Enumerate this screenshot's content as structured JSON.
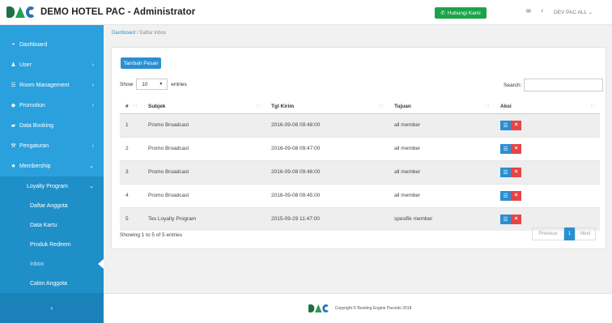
{
  "header": {
    "title": "DEMO HOTEL PAC - Administrator",
    "contact_button": "Hubungi Kami",
    "user_menu": "DEV PAC ALL"
  },
  "sidebar": {
    "items": [
      {
        "label": "Dashboard",
        "icon": "dashboard-icon",
        "chevron": ""
      },
      {
        "label": "User",
        "icon": "user-icon",
        "chevron": "›"
      },
      {
        "label": "Room Management",
        "icon": "list-icon",
        "chevron": "›"
      },
      {
        "label": "Promotion",
        "icon": "tag-icon",
        "chevron": "›"
      },
      {
        "label": "Data Booking",
        "icon": "book-icon",
        "chevron": ""
      },
      {
        "label": "Pengaturan",
        "icon": "wrench-icon",
        "chevron": "›"
      },
      {
        "label": "Membership",
        "icon": "star-icon",
        "chevron": "⌄"
      }
    ],
    "submenu": {
      "label": "Loyalty Program",
      "chevron": "⌄"
    },
    "sub_items": [
      "Daftar Anggota",
      "Data Kartu",
      "Produk Redeem",
      "Inbox",
      "Calon Anggota"
    ],
    "collapse_label": "‹"
  },
  "breadcrumb": {
    "home": "Dashboard",
    "separator": "/",
    "current": "Daftar Inbox"
  },
  "panel": {
    "add_button": "Tambah Pesan",
    "show_label": "Show",
    "show_value": "10",
    "entries_label": "entries",
    "search_label": "Search:",
    "search_value": ""
  },
  "table": {
    "columns": [
      "#",
      "Subjek",
      "Tgl Kirim",
      "Tujuan",
      "Aksi"
    ],
    "rows": [
      [
        "1",
        "Promo Broadcast",
        "2016-09-08 09:48:00",
        "all member"
      ],
      [
        "2",
        "Promo Broadcast",
        "2016-09-08 09:47:00",
        "all member"
      ],
      [
        "3",
        "Promo Broadcast",
        "2016-09-08 09:46:00",
        "all member"
      ],
      [
        "4",
        "Promo Broadcast",
        "2016-09-08 09:45:00",
        "all member"
      ],
      [
        "5",
        "Tes Loyalty Program",
        "2015-09-29 11:47:00",
        "spesifik member"
      ]
    ]
  },
  "pagination": {
    "info": "Showing 1 to 5 of 5 entries",
    "previous": "Previous",
    "current": "1",
    "next": "Next"
  },
  "footer": {
    "copyright": "Copyright © Booking Engine Pacindo 2018"
  },
  "colors": {
    "sidebar": "#2aa0dc",
    "primary": "#2a8fd1",
    "success": "#1aa34a",
    "danger": "#e64545"
  }
}
